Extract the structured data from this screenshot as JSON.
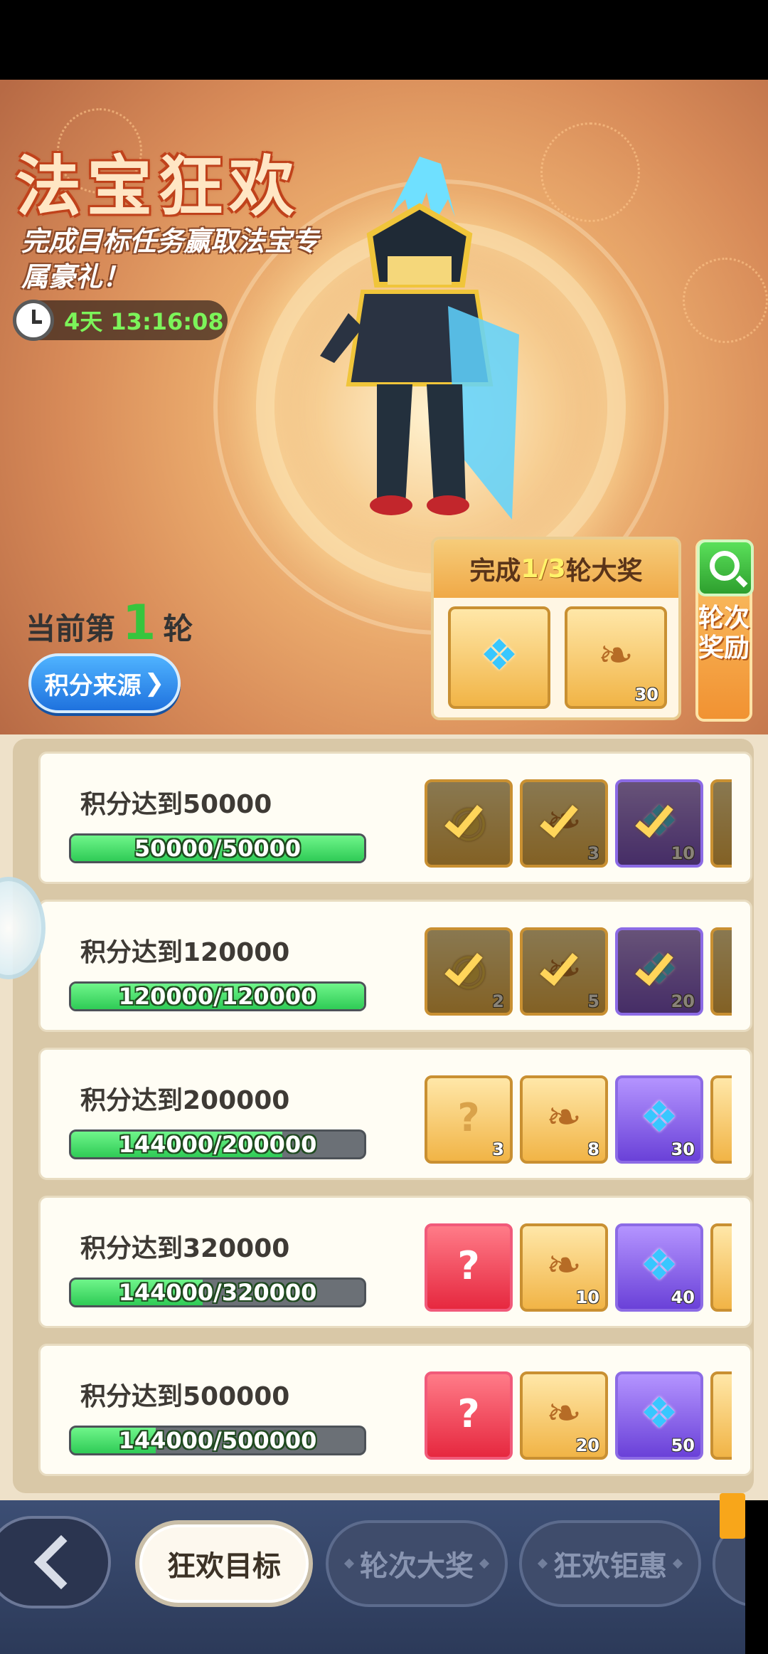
{
  "header": {
    "title": "法宝狂欢",
    "subtitle": "完成目标任务赢取法宝专属豪礼！",
    "timer": "4天 13:16:08"
  },
  "round": {
    "prefix": "当前第",
    "number": "1",
    "suffix": "轮",
    "points_source_label": "积分来源",
    "panel_prefix": "完成",
    "panel_progress": "1/3",
    "panel_suffix": "轮大奖",
    "panel_items": [
      {
        "icon": "treasure-chest-icon",
        "count": ""
      },
      {
        "icon": "scroll-icon",
        "count": "30"
      }
    ],
    "reward_button_label": "轮次奖励"
  },
  "tasks": [
    {
      "title": "积分达到50000",
      "progress_text": "50000/50000",
      "progress": 1.0,
      "claimed": true,
      "items": [
        {
          "icon": "bag-icon",
          "count": "",
          "color": "gold"
        },
        {
          "icon": "scroll-icon",
          "count": "3",
          "color": "gold"
        },
        {
          "icon": "gem-icon",
          "count": "10",
          "color": "purple"
        }
      ]
    },
    {
      "title": "积分达到120000",
      "progress_text": "120000/120000",
      "progress": 1.0,
      "claimed": true,
      "items": [
        {
          "icon": "bag-icon",
          "count": "2",
          "color": "gold"
        },
        {
          "icon": "scroll-icon",
          "count": "5",
          "color": "gold"
        },
        {
          "icon": "gem-icon",
          "count": "20",
          "color": "purple"
        }
      ]
    },
    {
      "title": "积分达到200000",
      "progress_text": "144000/200000",
      "progress": 0.72,
      "claimed": false,
      "items": [
        {
          "icon": "mystery-bag-icon",
          "count": "3",
          "color": "gold"
        },
        {
          "icon": "scroll-icon",
          "count": "8",
          "color": "gold"
        },
        {
          "icon": "gem-icon",
          "count": "30",
          "color": "purple"
        }
      ]
    },
    {
      "title": "积分达到320000",
      "progress_text": "144000/320000",
      "progress": 0.45,
      "claimed": false,
      "items": [
        {
          "icon": "mystery-bag-icon",
          "count": "",
          "color": "red"
        },
        {
          "icon": "scroll-icon",
          "count": "10",
          "color": "gold"
        },
        {
          "icon": "gem-icon",
          "count": "40",
          "color": "purple"
        }
      ]
    },
    {
      "title": "积分达到500000",
      "progress_text": "144000/500000",
      "progress": 0.288,
      "claimed": false,
      "items": [
        {
          "icon": "mystery-bag-icon",
          "count": "",
          "color": "red"
        },
        {
          "icon": "scroll-icon",
          "count": "20",
          "color": "gold"
        },
        {
          "icon": "gem-icon",
          "count": "50",
          "color": "purple"
        }
      ]
    }
  ],
  "nav": {
    "tabs": [
      {
        "label": "狂欢目标",
        "active": true
      },
      {
        "label": "轮次大奖",
        "active": false
      },
      {
        "label": "狂欢钜惠",
        "active": false
      }
    ]
  },
  "colors": {
    "progress_green": "#2fcb56",
    "accent_orange": "#f19232",
    "nav_bg": "#2c3a59"
  }
}
